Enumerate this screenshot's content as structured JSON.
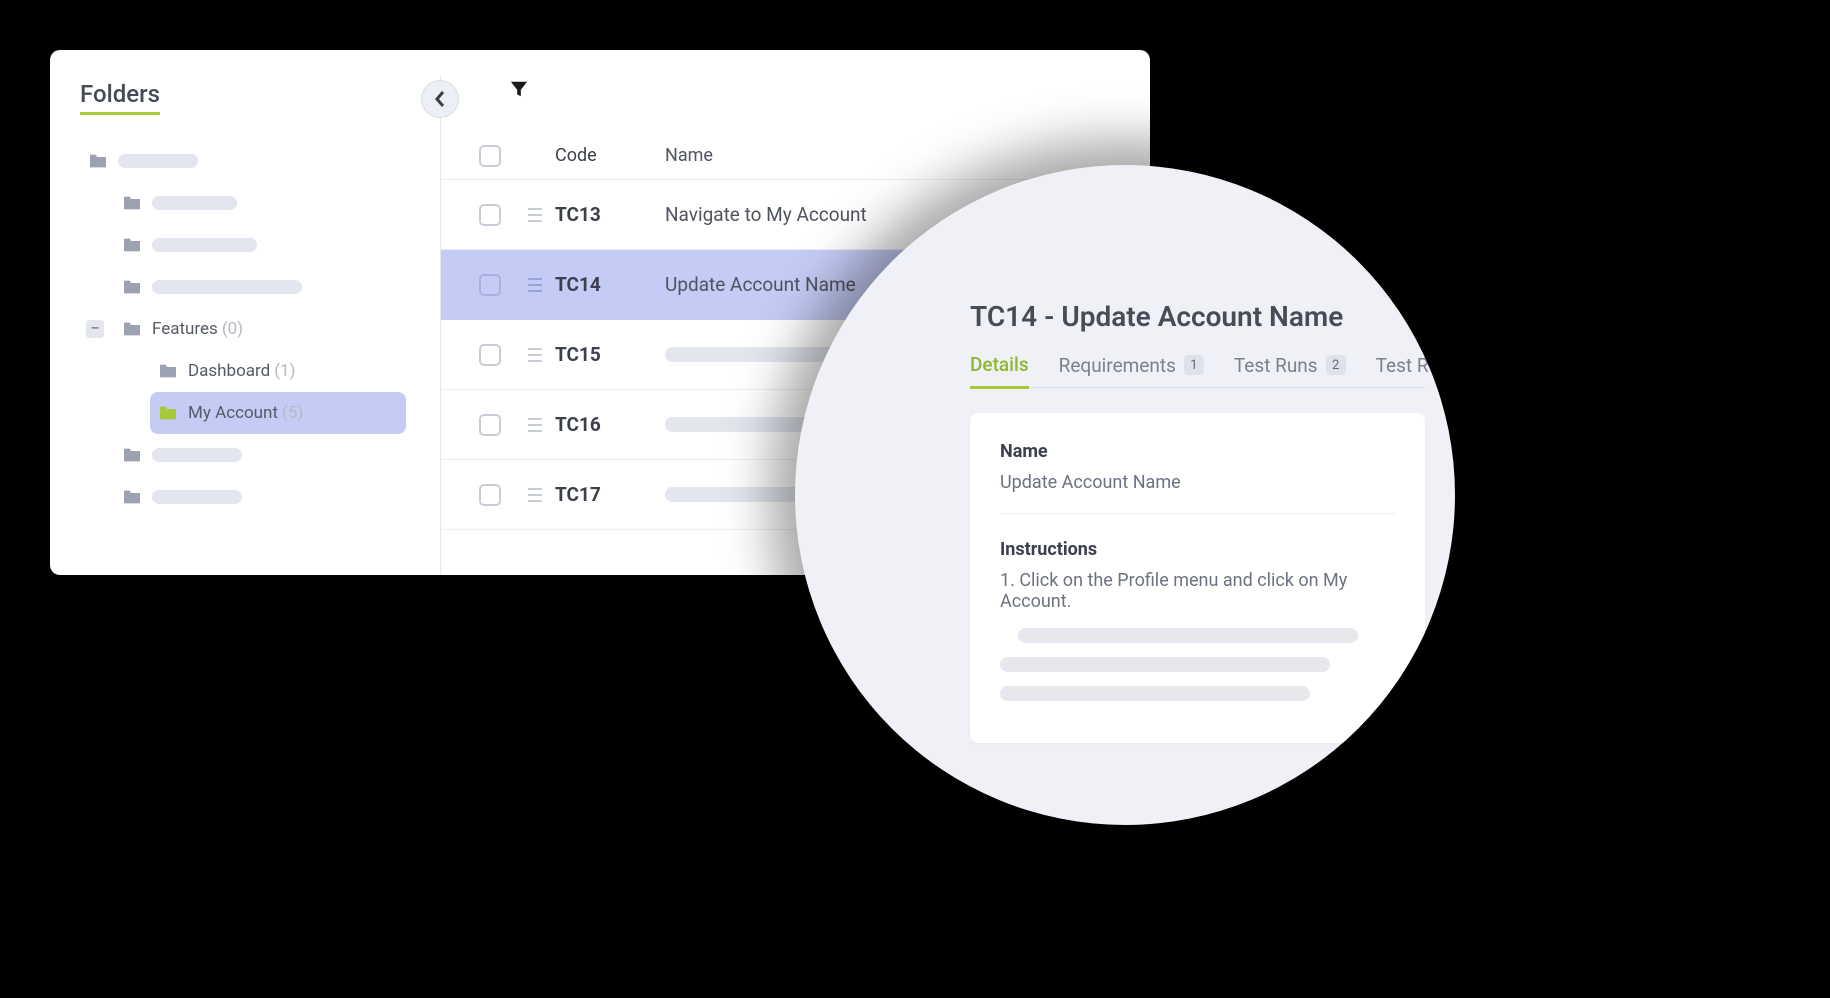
{
  "sidebar": {
    "title": "Folders",
    "tree": [
      {
        "placeholder_width": 80,
        "lvl": 0
      },
      {
        "placeholder_width": 85,
        "lvl": 1
      },
      {
        "placeholder_width": 105,
        "lvl": 1
      },
      {
        "placeholder_width": 150,
        "lvl": 1
      },
      {
        "label": "Features",
        "count": "(0)",
        "lvl": 1,
        "expanded": true
      },
      {
        "label": "Dashboard",
        "count": "(1)",
        "lvl": 2
      },
      {
        "label": "My Account",
        "count": "(5)",
        "lvl": 2,
        "selected": true
      },
      {
        "placeholder_width": 90,
        "lvl": 1
      },
      {
        "placeholder_width": 90,
        "lvl": 1
      }
    ]
  },
  "table": {
    "headers": {
      "code": "Code",
      "name": "Name"
    },
    "rows": [
      {
        "code": "TC13",
        "name": "Navigate to My Account"
      },
      {
        "code": "TC14",
        "name": "Update Account Name",
        "selected": true
      },
      {
        "code": "TC15",
        "placeholder_width": 230
      },
      {
        "code": "TC16",
        "placeholder_width": 270
      },
      {
        "code": "TC17",
        "placeholder_width": 230
      }
    ]
  },
  "detail": {
    "title": "TC14 - Update Account Name",
    "tabs": [
      {
        "label": "Details",
        "active": true
      },
      {
        "label": "Requirements",
        "badge": "1"
      },
      {
        "label": "Test Runs",
        "badge": "2"
      },
      {
        "label": "Test Results"
      }
    ],
    "name_label": "Name",
    "name_value": "Update Account Name",
    "instructions_label": "Instructions",
    "instruction_1": "1. Click on the Profile menu and click on My Account."
  }
}
